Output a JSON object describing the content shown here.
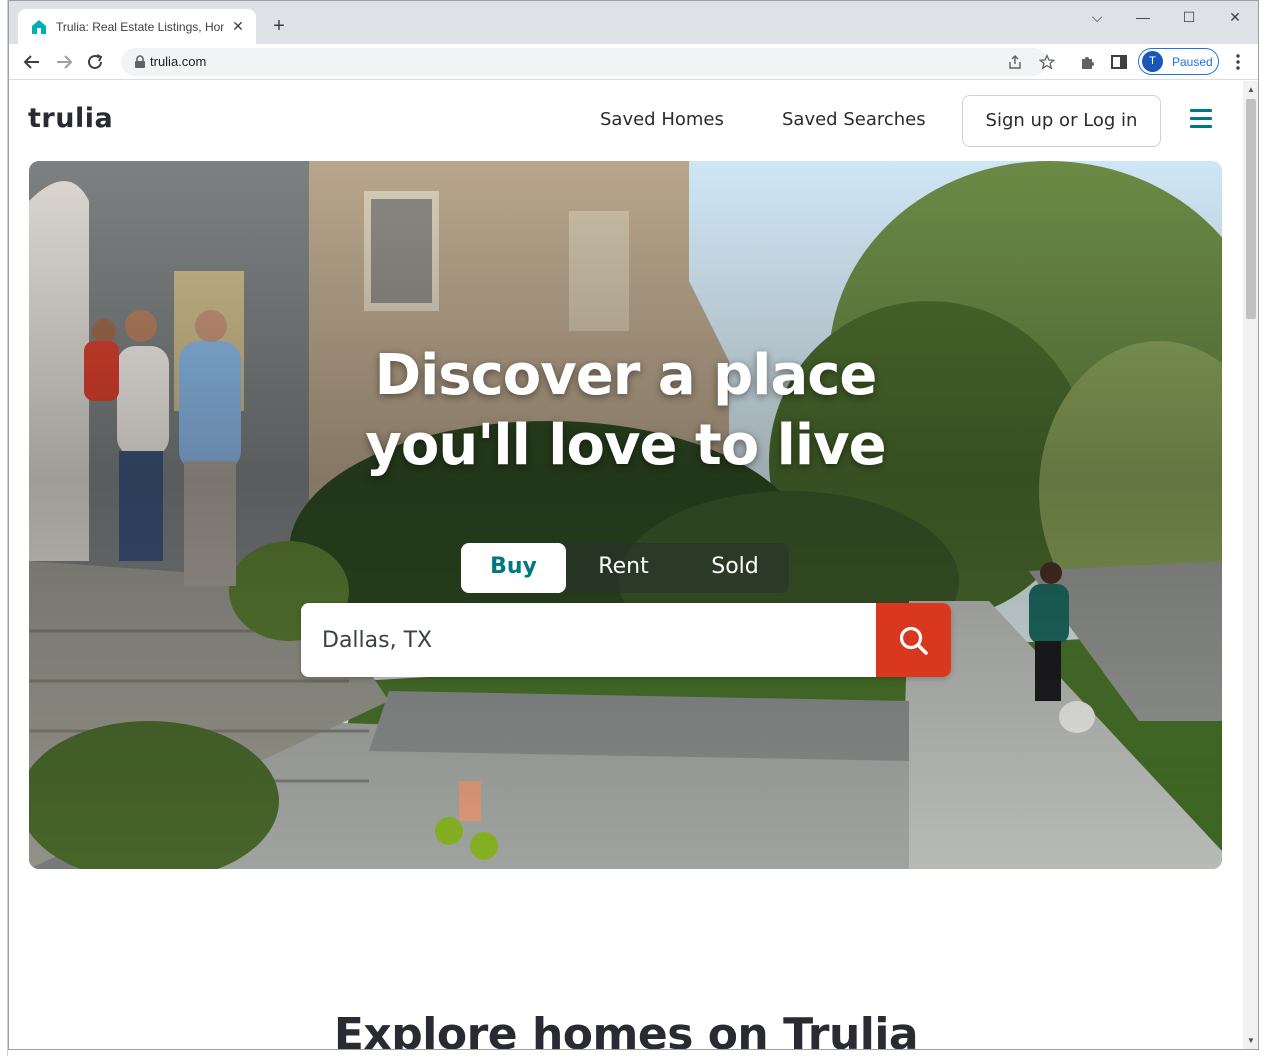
{
  "browser": {
    "tab_title": "Trulia: Real Estate Listings, Home",
    "new_tab": "+",
    "url": "trulia.com",
    "profile_initial": "T",
    "profile_status": "Paused"
  },
  "site": {
    "logo": "trulia",
    "nav": {
      "saved_homes": "Saved Homes",
      "saved_searches": "Saved Searches",
      "login": "Sign up or Log in"
    },
    "hero": {
      "headline_line1": "Discover a place",
      "headline_line2": "you'll love to live",
      "tabs": [
        "Buy",
        "Rent",
        "Sold"
      ],
      "active_tab": "Buy",
      "search_value": "Dallas, TX"
    },
    "explore_heading": "Explore homes on Trulia"
  },
  "colors": {
    "brand_teal": "#007882",
    "search_red": "#d9381e",
    "text_dark": "#2a2a33"
  }
}
